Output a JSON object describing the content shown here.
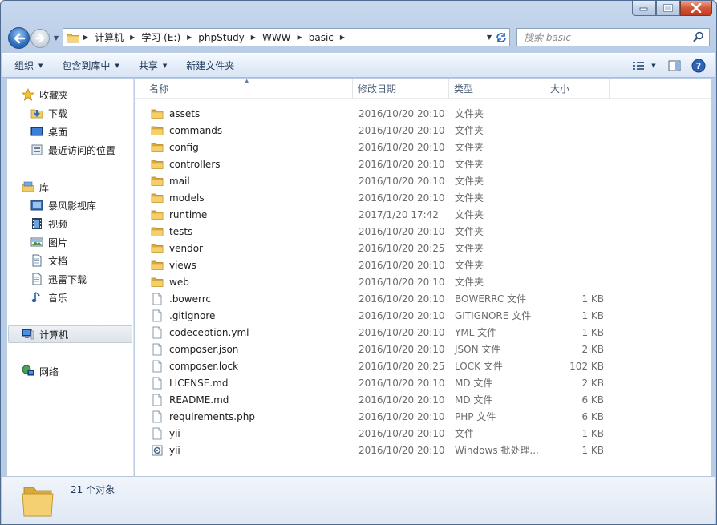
{
  "window": {
    "caption_buttons": {
      "minimize": "—",
      "maximize": "□",
      "close": "✕"
    }
  },
  "address": {
    "crumbs": [
      "计算机",
      "学习 (E:)",
      "phpStudy",
      "WWW",
      "basic"
    ]
  },
  "search": {
    "placeholder": "搜索 basic"
  },
  "toolbar": {
    "organize": "组织",
    "include_in_library": "包含到库中",
    "share": "共享",
    "new_folder": "新建文件夹"
  },
  "nav": {
    "favorites": {
      "label": "收藏夹",
      "items": [
        "下载",
        "桌面",
        "最近访问的位置"
      ]
    },
    "libraries": {
      "label": "库",
      "items": [
        "暴风影视库",
        "视频",
        "图片",
        "文档",
        "迅雷下载",
        "音乐"
      ]
    },
    "computer": {
      "label": "计算机"
    },
    "network": {
      "label": "网络"
    }
  },
  "columns": {
    "name": "名称",
    "date": "修改日期",
    "type": "类型",
    "size": "大小"
  },
  "files": [
    {
      "name": "assets",
      "date": "2016/10/20 20:10",
      "type": "文件夹",
      "size": "",
      "icon": "folder-icon"
    },
    {
      "name": "commands",
      "date": "2016/10/20 20:10",
      "type": "文件夹",
      "size": "",
      "icon": "folder-icon"
    },
    {
      "name": "config",
      "date": "2016/10/20 20:10",
      "type": "文件夹",
      "size": "",
      "icon": "folder-icon"
    },
    {
      "name": "controllers",
      "date": "2016/10/20 20:10",
      "type": "文件夹",
      "size": "",
      "icon": "folder-icon"
    },
    {
      "name": "mail",
      "date": "2016/10/20 20:10",
      "type": "文件夹",
      "size": "",
      "icon": "folder-icon"
    },
    {
      "name": "models",
      "date": "2016/10/20 20:10",
      "type": "文件夹",
      "size": "",
      "icon": "folder-icon"
    },
    {
      "name": "runtime",
      "date": "2017/1/20 17:42",
      "type": "文件夹",
      "size": "",
      "icon": "folder-icon"
    },
    {
      "name": "tests",
      "date": "2016/10/20 20:10",
      "type": "文件夹",
      "size": "",
      "icon": "folder-icon"
    },
    {
      "name": "vendor",
      "date": "2016/10/20 20:25",
      "type": "文件夹",
      "size": "",
      "icon": "folder-icon"
    },
    {
      "name": "views",
      "date": "2016/10/20 20:10",
      "type": "文件夹",
      "size": "",
      "icon": "folder-icon"
    },
    {
      "name": "web",
      "date": "2016/10/20 20:10",
      "type": "文件夹",
      "size": "",
      "icon": "folder-icon"
    },
    {
      "name": ".bowerrc",
      "date": "2016/10/20 20:10",
      "type": "BOWERRC 文件",
      "size": "1 KB",
      "icon": "file-icon"
    },
    {
      "name": ".gitignore",
      "date": "2016/10/20 20:10",
      "type": "GITIGNORE 文件",
      "size": "1 KB",
      "icon": "file-icon"
    },
    {
      "name": "codeception.yml",
      "date": "2016/10/20 20:10",
      "type": "YML 文件",
      "size": "1 KB",
      "icon": "file-icon"
    },
    {
      "name": "composer.json",
      "date": "2016/10/20 20:10",
      "type": "JSON 文件",
      "size": "2 KB",
      "icon": "file-icon"
    },
    {
      "name": "composer.lock",
      "date": "2016/10/20 20:25",
      "type": "LOCK 文件",
      "size": "102 KB",
      "icon": "file-icon"
    },
    {
      "name": "LICENSE.md",
      "date": "2016/10/20 20:10",
      "type": "MD 文件",
      "size": "2 KB",
      "icon": "file-icon"
    },
    {
      "name": "README.md",
      "date": "2016/10/20 20:10",
      "type": "MD 文件",
      "size": "6 KB",
      "icon": "file-icon"
    },
    {
      "name": "requirements.php",
      "date": "2016/10/20 20:10",
      "type": "PHP 文件",
      "size": "6 KB",
      "icon": "file-icon"
    },
    {
      "name": "yii",
      "date": "2016/10/20 20:10",
      "type": "文件",
      "size": "1 KB",
      "icon": "file-icon"
    },
    {
      "name": "yii",
      "date": "2016/10/20 20:10",
      "type": "Windows 批处理...",
      "size": "1 KB",
      "icon": "batch-file-icon"
    }
  ],
  "status": {
    "count": "21 个对象"
  }
}
